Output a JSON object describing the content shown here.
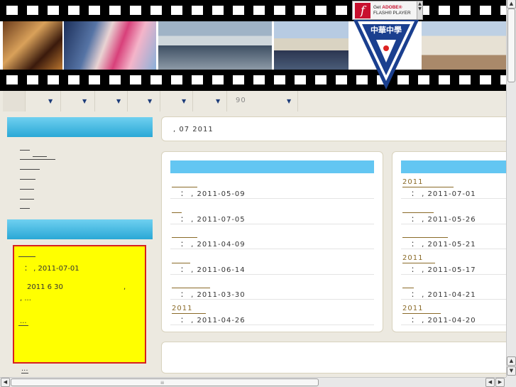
{
  "flash_badge": {
    "line1_get": "Get ",
    "line1_brand": "ADOBE®",
    "line2": "FLASH® PLAYER"
  },
  "logo": {
    "text": "中華中學"
  },
  "nav": {
    "items": [
      {
        "label": "",
        "has_arrow": false
      },
      {
        "label": "",
        "has_arrow": true
      },
      {
        "label": "",
        "has_arrow": true
      },
      {
        "label": "",
        "has_arrow": true
      },
      {
        "label": "",
        "has_arrow": true
      },
      {
        "label": "",
        "has_arrow": true
      },
      {
        "label": "90",
        "has_arrow": true
      }
    ]
  },
  "sidebar": {
    "header1": "",
    "header2": "",
    "highlight": {
      "date": "： , 2011-07-01",
      "body": "2011  6   30",
      "comma": ",",
      "more1": ", ...",
      "more2": "...",
      "link_more": "..."
    },
    "bottom_more": "..."
  },
  "main": {
    "date_bar": ", 07   2011",
    "left_news": [
      {
        "title": "",
        "date": "： , 2011-05-09"
      },
      {
        "title": "",
        "date": "： , 2011-07-05"
      },
      {
        "title": "",
        "date": "： , 2011-04-09"
      },
      {
        "title": "",
        "date": "： , 2011-06-14"
      },
      {
        "title": "",
        "date": "： , 2011-03-30"
      },
      {
        "title": "2011",
        "date": "： , 2011-04-26"
      }
    ],
    "right_news": [
      {
        "title": "2011",
        "date": "： , 2011-07-01"
      },
      {
        "title": "",
        "date": "： , 2011-05-26"
      },
      {
        "title": "",
        "date": "： , 2011-05-21"
      },
      {
        "title": "2011",
        "date": "： , 2011-05-17"
      },
      {
        "title": "",
        "date": "： , 2011-04-21"
      },
      {
        "title": "2011",
        "date": "： , 2011-04-20"
      }
    ],
    "section_title": ""
  },
  "colors": {
    "accent": "#63c6f2",
    "header_bg": "#2aa8d6",
    "highlight_bg": "#ffff00",
    "highlight_border": "#d62020",
    "page_bg": "#ece9e0"
  },
  "icons": [
    "flash-icon",
    "dropdown-arrow-icon",
    "scroll-up-icon",
    "scroll-down-icon",
    "scroll-left-icon",
    "scroll-right-icon"
  ]
}
